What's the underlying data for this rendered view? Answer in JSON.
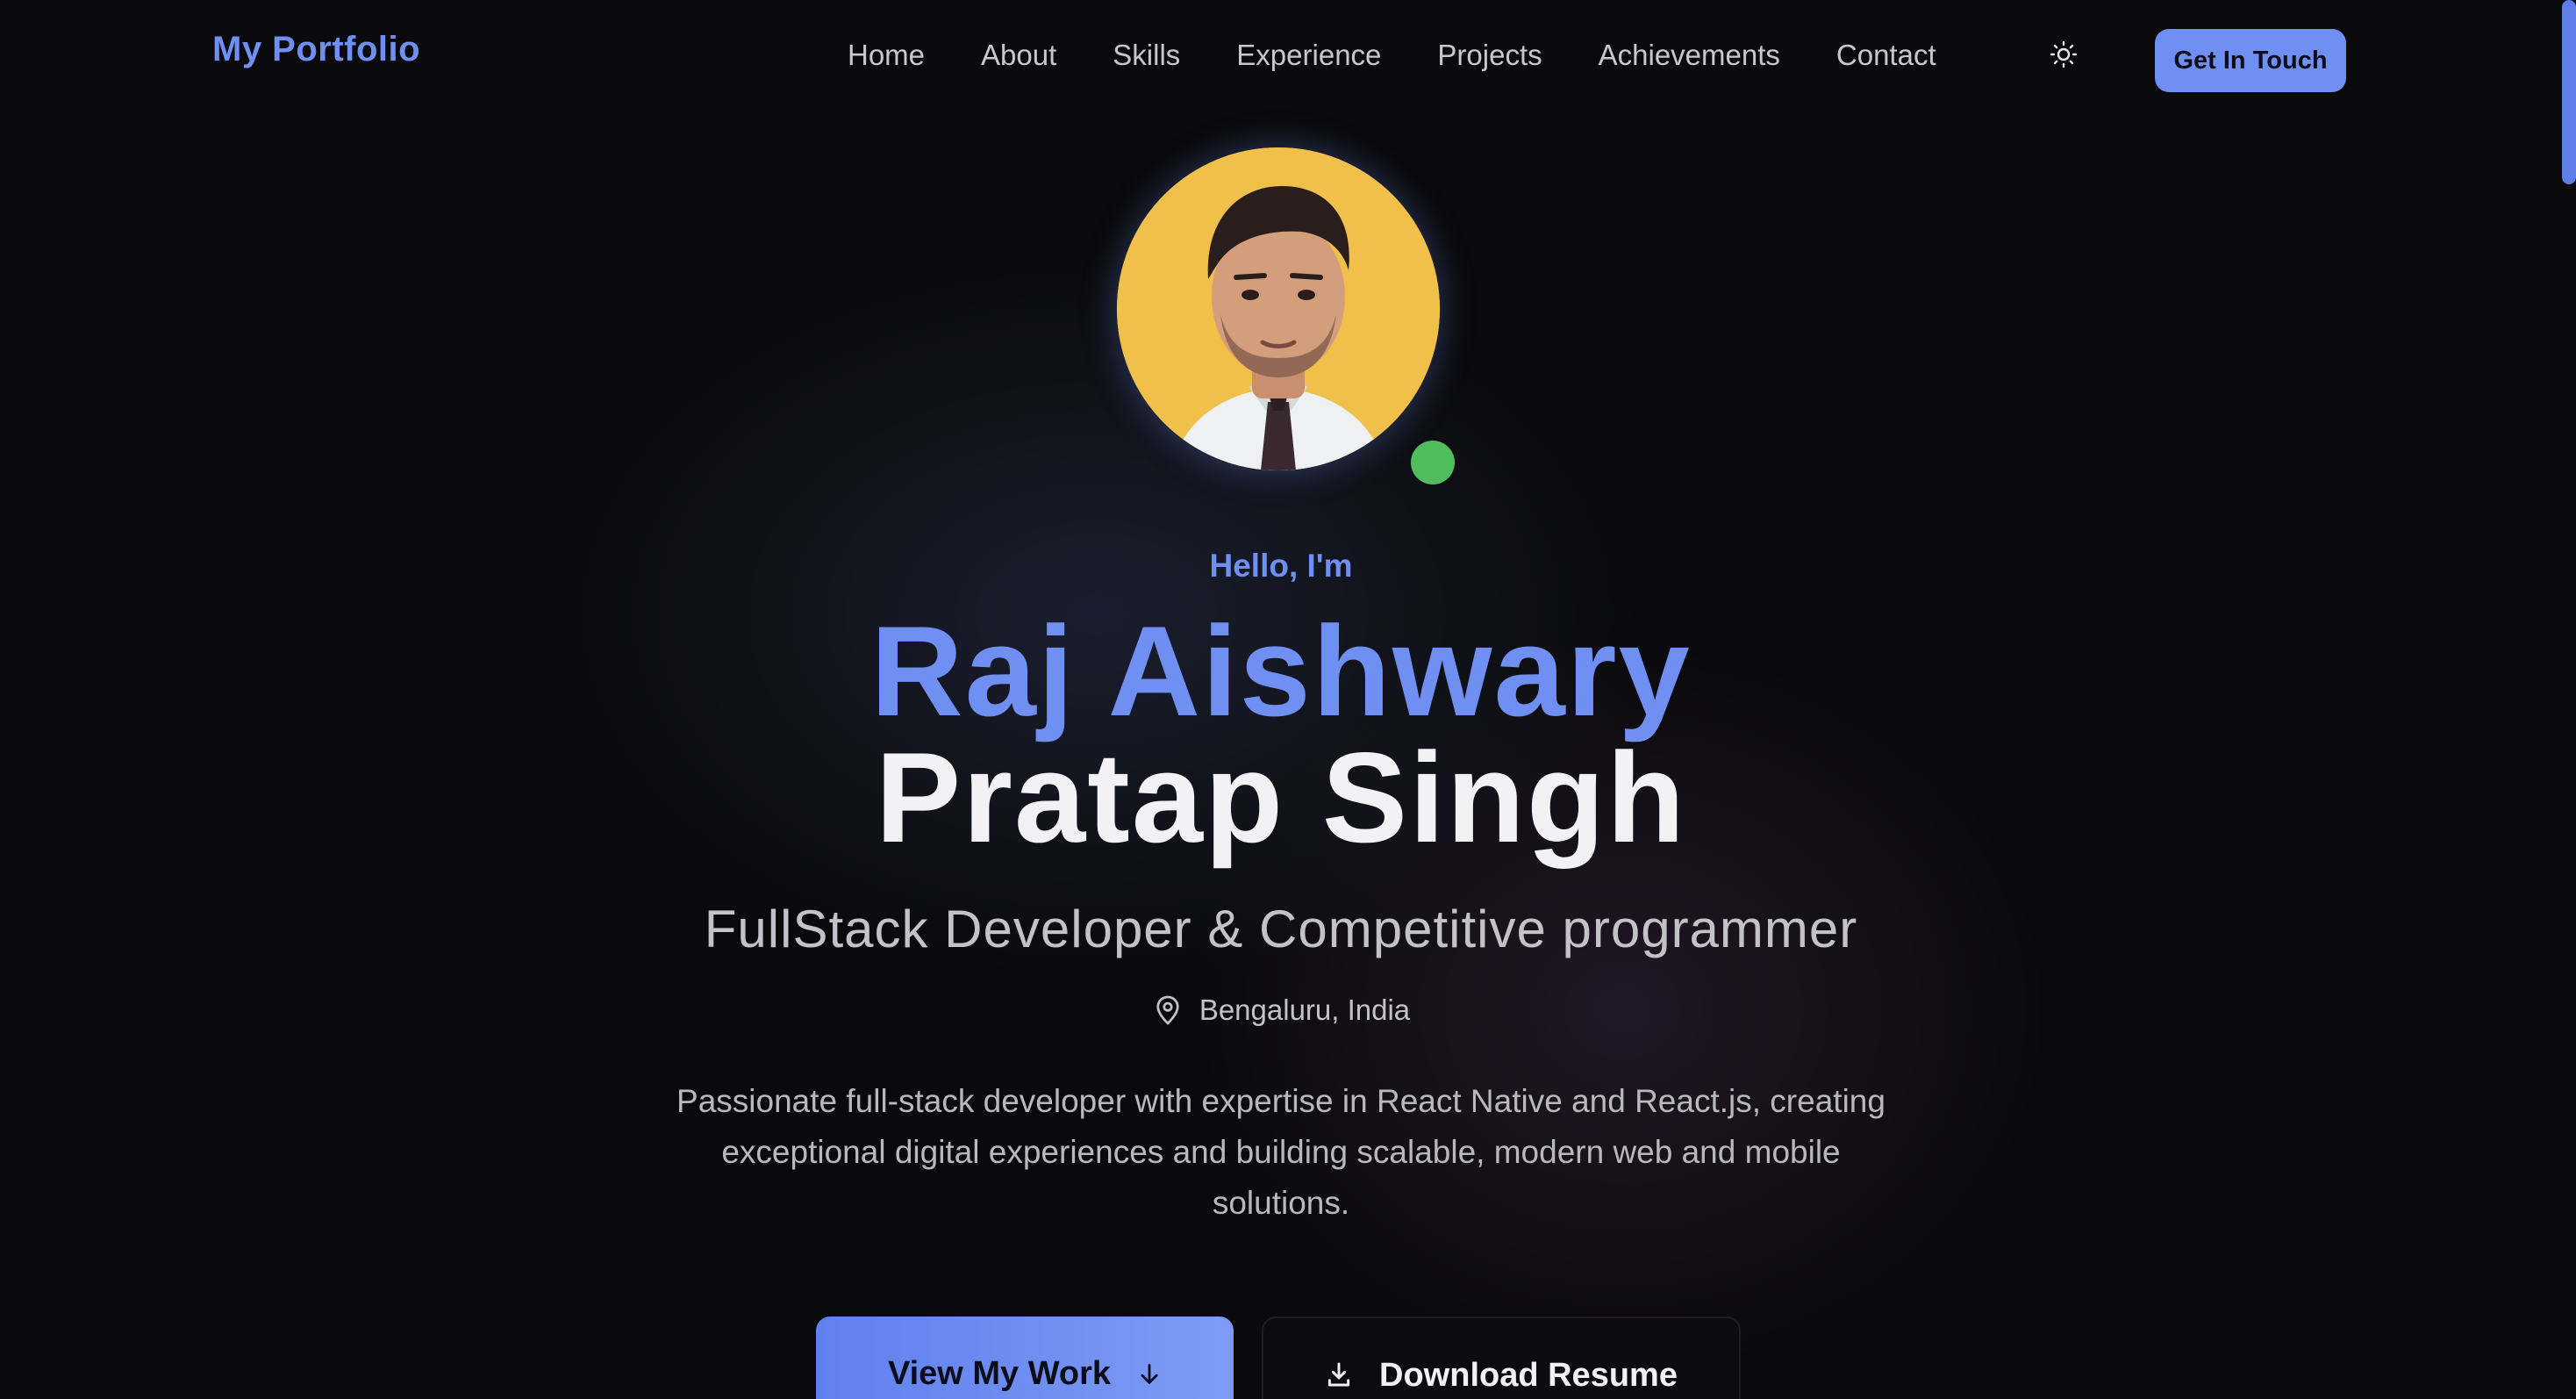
{
  "header": {
    "logo": "My Portfolio",
    "nav": [
      "Home",
      "About",
      "Skills",
      "Experience",
      "Projects",
      "Achievements",
      "Contact"
    ],
    "cta_label": "Get In Touch",
    "theme_icon": "sun-icon"
  },
  "hero": {
    "greeting": "Hello, I'm",
    "name_line1": "Raj Aishwary",
    "name_line2": "Pratap Singh",
    "role": "FullStack Developer & Competitive programmer",
    "location": "Bengaluru, India",
    "bio": "Passionate full-stack developer with expertise in React Native and React.js, creating exceptional digital experiences and building scalable, modern web and mobile solutions.",
    "primary_button": "View My Work",
    "secondary_button": "Download Resume"
  },
  "colors": {
    "accent": "#6f8ff2",
    "background": "#0a0a0c",
    "status_online": "#4fbd5b",
    "avatar_bg": "#f0c04a"
  }
}
